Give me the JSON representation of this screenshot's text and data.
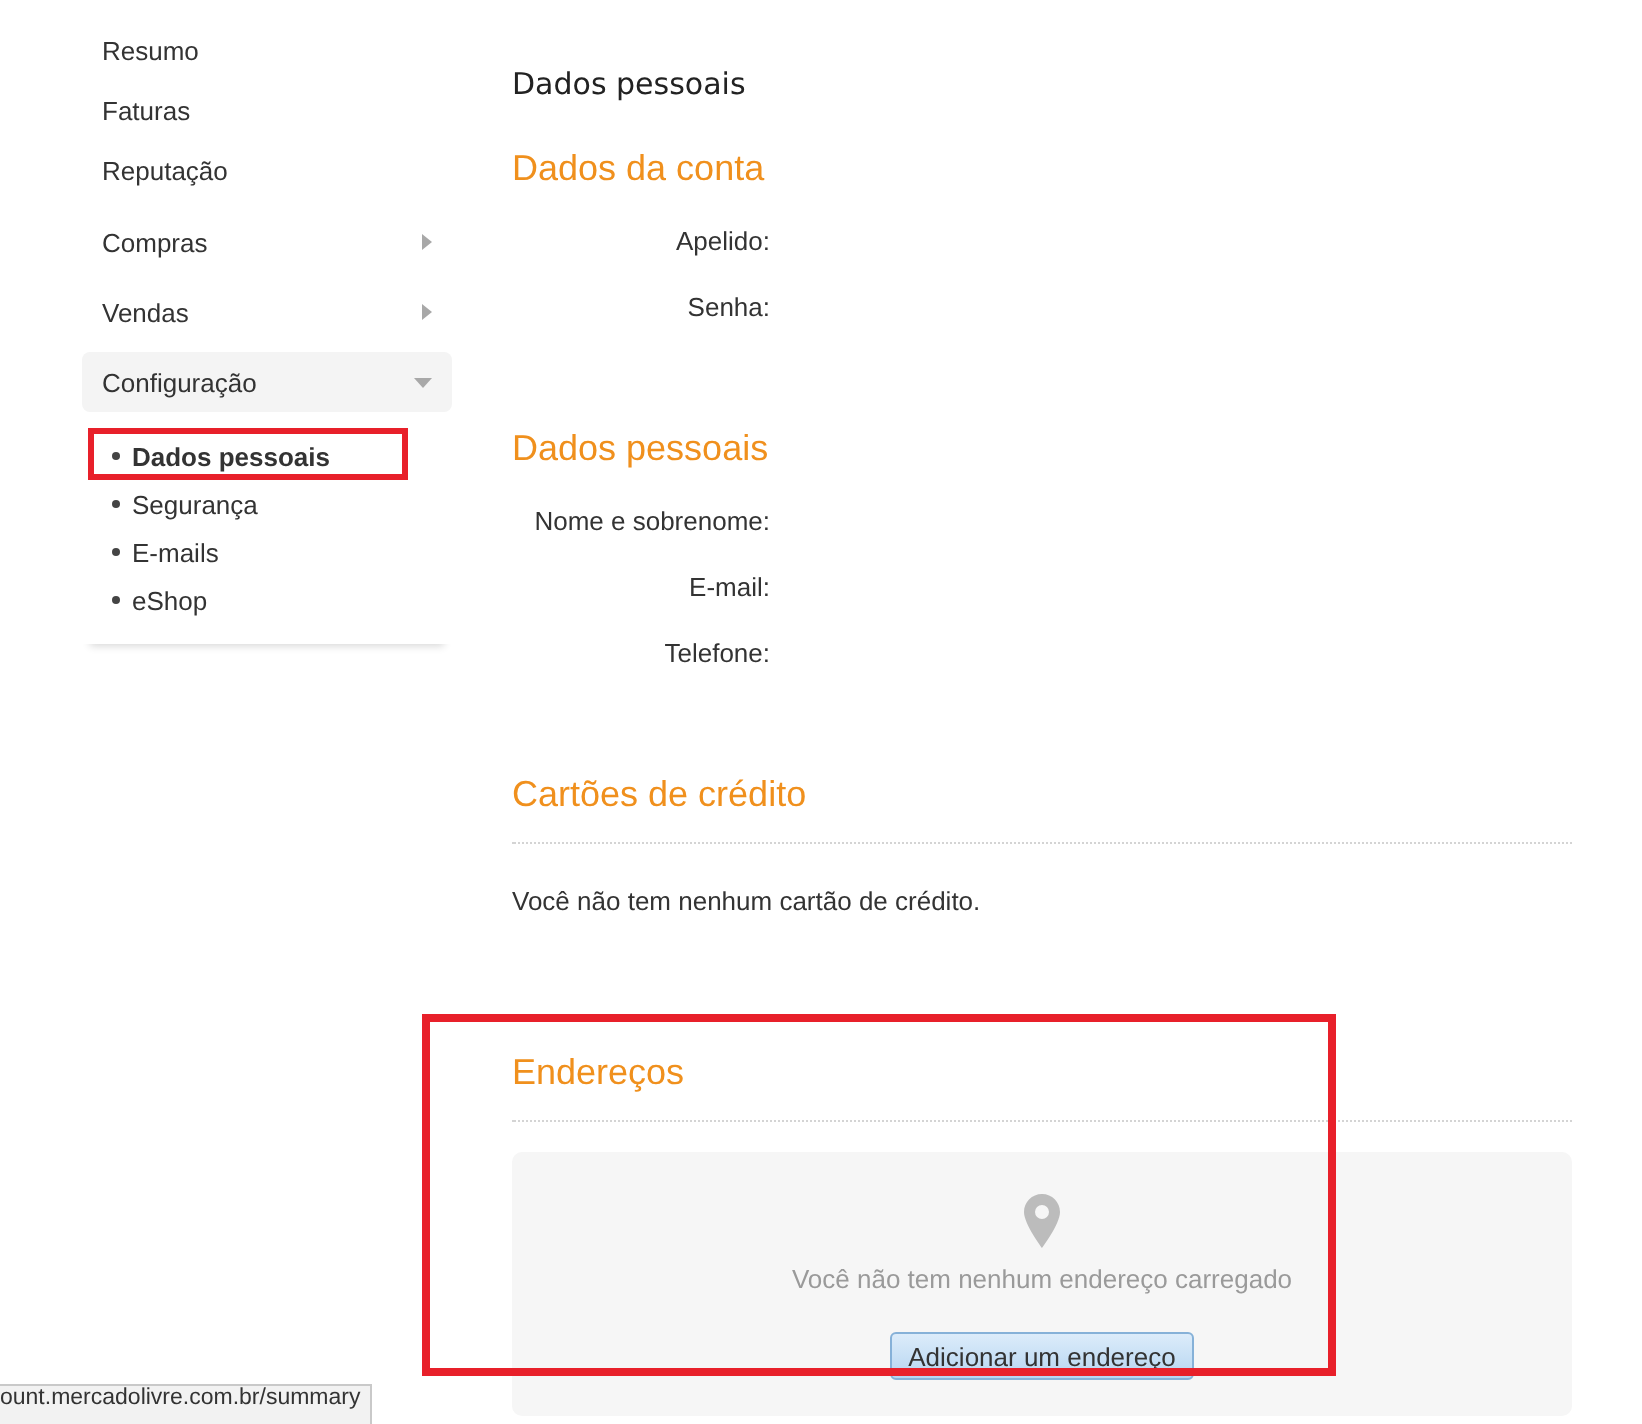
{
  "sidebar": {
    "items": [
      {
        "kind": "link",
        "label": "Resumo"
      },
      {
        "kind": "link",
        "label": "Faturas"
      },
      {
        "kind": "link",
        "label": "Reputação"
      },
      {
        "kind": "menu",
        "label": "Compras",
        "expanded": false
      },
      {
        "kind": "menu",
        "label": "Vendas",
        "expanded": false
      },
      {
        "kind": "menu",
        "label": "Configuração",
        "expanded": true,
        "children": [
          {
            "label": "Dados pessoais",
            "selected": true,
            "highlighted": true
          },
          {
            "label": "Segurança",
            "selected": false,
            "highlighted": false
          },
          {
            "label": "E-mails",
            "selected": false,
            "highlighted": false
          },
          {
            "label": "eShop",
            "selected": false,
            "highlighted": false
          }
        ]
      }
    ]
  },
  "page_title": "Dados pessoais",
  "sections": [
    {
      "kind": "fields",
      "title": "Dados da conta",
      "highlighted": false,
      "fields": [
        {
          "label": "Apelido:"
        },
        {
          "label": "Senha:"
        }
      ]
    },
    {
      "kind": "fields",
      "title": "Dados pessoais",
      "highlighted": false,
      "fields": [
        {
          "label": "Nome e sobrenome:"
        },
        {
          "label": "E-mail:"
        },
        {
          "label": "Telefone:"
        }
      ]
    },
    {
      "kind": "message",
      "title": "Cartões de crédito",
      "highlighted": false,
      "message": "Você não tem nenhum cartão de crédito."
    },
    {
      "kind": "empty_state",
      "title": "Endereços",
      "highlighted": true,
      "message": "Você não tem nenhum endereço carregado",
      "button": "Adicionar um endereço"
    }
  ],
  "status_bar": {
    "url": "ount.mercadolivre.com.br/summary"
  }
}
